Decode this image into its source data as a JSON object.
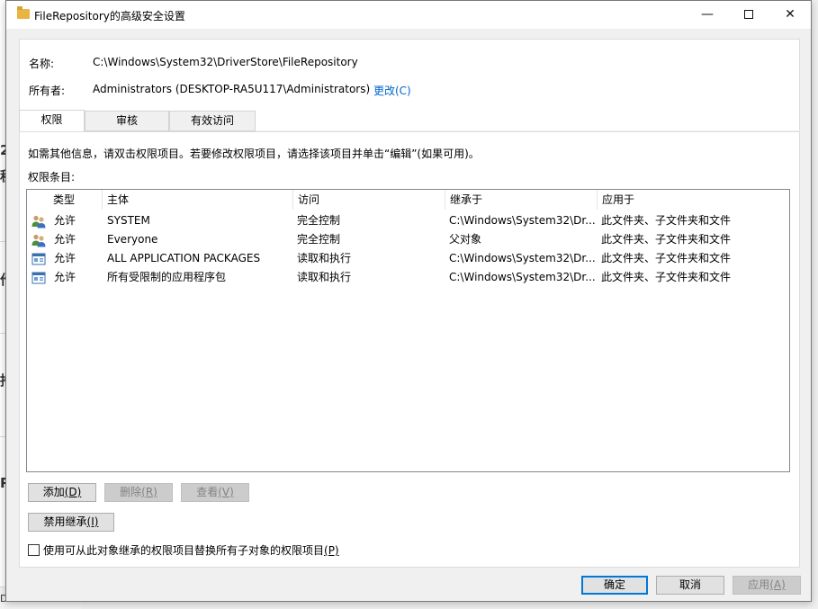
{
  "window": {
    "title": "FileRepository的高级安全设置",
    "controls": {
      "minimize": "—",
      "maximize": "",
      "close": "✕"
    }
  },
  "background_window": {
    "glyphs": [
      "2y",
      "程",
      "作",
      "持",
      "R",
      "D"
    ]
  },
  "header": {
    "name_label": "名称:",
    "name_value": "C:\\Windows\\System32\\DriverStore\\FileRepository",
    "owner_label": "所有者:",
    "owner_value": "Administrators (DESKTOP-RA5U117\\Administrators)",
    "change_link": "更改(C)"
  },
  "tabs": [
    {
      "label": "权限",
      "active": true
    },
    {
      "label": "审核",
      "active": false
    },
    {
      "label": "有效访问",
      "active": false
    }
  ],
  "info_text": "如需其他信息，请双击权限项目。若要修改权限项目，请选择该项目并单击“编辑”(如果可用)。",
  "entries_label": "权限条目:",
  "table": {
    "columns": [
      "类型",
      "主体",
      "访问",
      "继承于",
      "应用于"
    ],
    "rows": [
      {
        "icon": "users-group-icon",
        "type": "允许",
        "principal": "SYSTEM",
        "access": "完全控制",
        "inherited": "C:\\Windows\\System32\\Dr...",
        "applies": "此文件夹、子文件夹和文件"
      },
      {
        "icon": "users-group-icon",
        "type": "允许",
        "principal": "Everyone",
        "access": "完全控制",
        "inherited": "父对象",
        "applies": "此文件夹、子文件夹和文件"
      },
      {
        "icon": "app-package-icon",
        "type": "允许",
        "principal": "ALL APPLICATION PACKAGES",
        "access": "读取和执行",
        "inherited": "C:\\Windows\\System32\\Dr...",
        "applies": "此文件夹、子文件夹和文件"
      },
      {
        "icon": "app-package-icon",
        "type": "允许",
        "principal": "所有受限制的应用程序包",
        "access": "读取和执行",
        "inherited": "C:\\Windows\\System32\\Dr...",
        "applies": "此文件夹、子文件夹和文件"
      }
    ]
  },
  "buttons": {
    "add": {
      "text": "添加",
      "key": "(D)"
    },
    "remove": {
      "text": "删除",
      "key": "(R)"
    },
    "view": {
      "text": "查看",
      "key": "(V)"
    },
    "disable_inheritance": {
      "text": "禁用继承",
      "key": "(I)"
    },
    "ok": "确定",
    "cancel": "取消",
    "apply": {
      "text": "应用",
      "key": "(A)"
    }
  },
  "replace_checkbox": {
    "label": "使用可从此对象继承的权限项目替换所有子对象的权限项目",
    "key": "(P)",
    "checked": false
  },
  "colors": {
    "accent": "#0078d7",
    "link": "#0066cc"
  }
}
